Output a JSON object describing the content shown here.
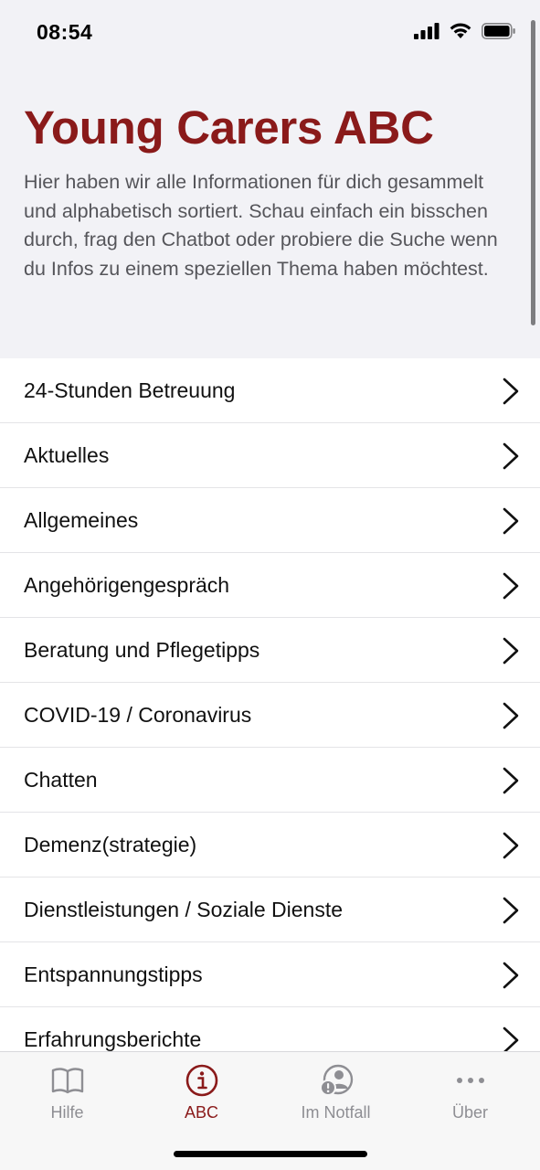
{
  "status_bar": {
    "time": "08:54"
  },
  "header": {
    "title": "Young Carers ABC",
    "intro": "Hier haben wir alle Informationen für dich gesammelt und alphabetisch sortiert. Schau einfach ein bisschen durch, frag den Chatbot oder probiere die Suche wenn du Infos zu einem speziellen Thema haben möchtest."
  },
  "list": {
    "items": [
      {
        "label": "24-Stunden Betreuung"
      },
      {
        "label": "Aktuelles"
      },
      {
        "label": "Allgemeines"
      },
      {
        "label": "Angehörigengespräch"
      },
      {
        "label": "Beratung und Pflegetipps"
      },
      {
        "label": "COVID-19 / Coronavirus"
      },
      {
        "label": "Chatten"
      },
      {
        "label": "Demenz(strategie)"
      },
      {
        "label": "Dienstleistungen / Soziale Dienste"
      },
      {
        "label": "Entspannungstipps"
      },
      {
        "label": "Erfahrungsberichte"
      }
    ]
  },
  "tabs": [
    {
      "label": "Hilfe",
      "icon": "book-icon",
      "active": false
    },
    {
      "label": "ABC",
      "icon": "info-icon",
      "active": true
    },
    {
      "label": "Im Notfall",
      "icon": "emergency-person-icon",
      "active": false
    },
    {
      "label": "Über",
      "icon": "more-icon",
      "active": false
    }
  ],
  "colors": {
    "accent": "#8a1a1a",
    "inactive_tab": "#8e8e93",
    "background": "#f2f2f6"
  }
}
